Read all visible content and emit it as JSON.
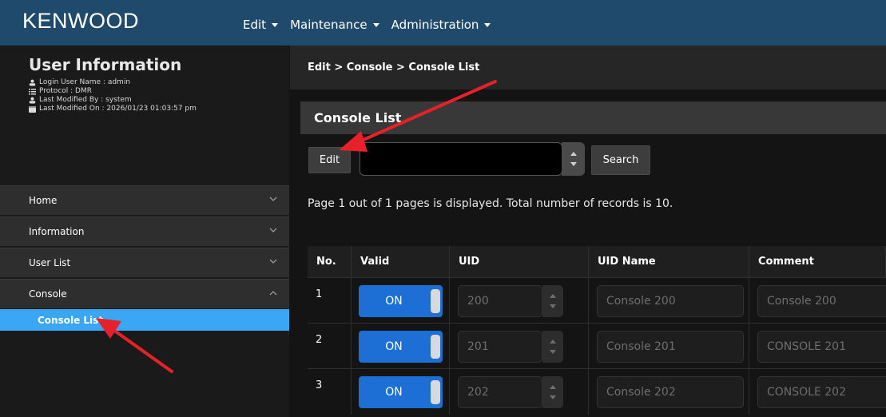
{
  "app": {
    "brand": "KENWOOD"
  },
  "nav": {
    "items": [
      {
        "label": "Edit"
      },
      {
        "label": "Maintenance"
      },
      {
        "label": "Administration"
      }
    ]
  },
  "user_info": {
    "title": "User Information",
    "login_user": "Login User Name : admin",
    "protocol": "Protocol : DMR",
    "modified_by": "Last Modified By : system",
    "modified_on": "Last Modified On : 2026/01/23 01:03:57 pm"
  },
  "sidebar": {
    "items": [
      {
        "label": "Home",
        "expanded": false
      },
      {
        "label": "Information",
        "expanded": false
      },
      {
        "label": "User List",
        "expanded": false
      },
      {
        "label": "Console",
        "expanded": true
      }
    ],
    "submenu": {
      "label": "Console List"
    }
  },
  "breadcrumb": "Edit  >  Console  >  Console List",
  "section": {
    "title": "Console List"
  },
  "toolbar": {
    "edit_label": "Edit",
    "search_label": "Search",
    "search_value": ""
  },
  "page_info": "Page 1 out of 1 pages is displayed. Total number of records is 10.",
  "table": {
    "headers": [
      "No.",
      "Valid",
      "UID",
      "UID Name",
      "Comment"
    ],
    "rows": [
      {
        "no": "1",
        "valid": "ON",
        "uid": "200",
        "uid_name": "Console 200",
        "comment": "Console 200"
      },
      {
        "no": "2",
        "valid": "ON",
        "uid": "201",
        "uid_name": "Console 201",
        "comment": "CONSOLE 201"
      },
      {
        "no": "3",
        "valid": "ON",
        "uid": "202",
        "uid_name": "Console 202",
        "comment": "CONSOLE 202"
      }
    ]
  },
  "colors": {
    "topbar": "#1f4a6b",
    "accent": "#3aa6f6",
    "toggle_on": "#1d6fd6",
    "annotation_arrow": "#e8202a"
  },
  "icons": {
    "user": "user-icon",
    "protocol": "list-icon",
    "modified_by": "user-icon",
    "modified_on": "calendar-icon"
  }
}
